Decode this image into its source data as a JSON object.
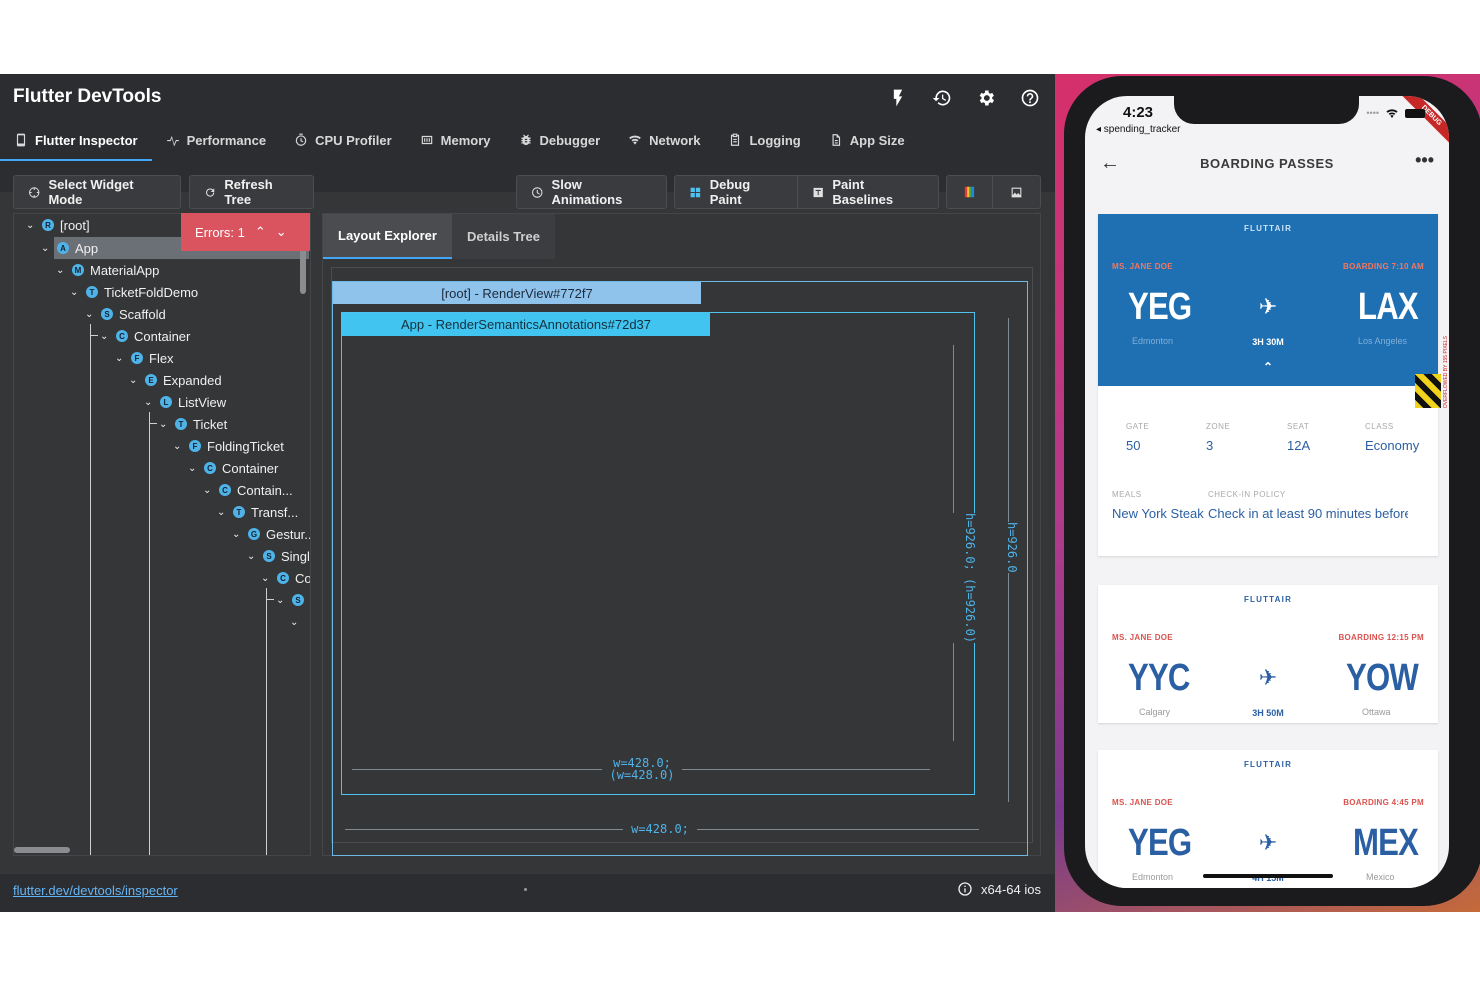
{
  "app": {
    "title": "Flutter DevTools",
    "tabs": [
      {
        "label": "Flutter Inspector",
        "icon": "phone-icon",
        "active": true
      },
      {
        "label": "Performance",
        "icon": "performance-icon"
      },
      {
        "label": "CPU Profiler",
        "icon": "timer-icon"
      },
      {
        "label": "Memory",
        "icon": "memory-icon"
      },
      {
        "label": "Debugger",
        "icon": "bug-icon"
      },
      {
        "label": "Network",
        "icon": "wifi-icon"
      },
      {
        "label": "Logging",
        "icon": "clipboard-icon"
      },
      {
        "label": "App Size",
        "icon": "file-icon"
      }
    ]
  },
  "toolbar": {
    "select_widget_mode": "Select Widget Mode",
    "refresh_tree": "Refresh Tree",
    "slow_animations": "Slow Animations",
    "debug_paint": "Debug Paint",
    "paint_baselines": "Paint Baselines"
  },
  "tree": {
    "errors_label": "Errors: 1",
    "nodes": [
      {
        "label": "[root]",
        "badge": "R"
      },
      {
        "label": "App",
        "badge": "A"
      },
      {
        "label": "MaterialApp",
        "badge": "M"
      },
      {
        "label": "TicketFoldDemo",
        "badge": "T"
      },
      {
        "label": "Scaffold",
        "badge": "S"
      },
      {
        "label": "Container",
        "badge": "C"
      },
      {
        "label": "Flex",
        "badge": "F"
      },
      {
        "label": "Expanded",
        "badge": "E"
      },
      {
        "label": "ListView",
        "badge": "L"
      },
      {
        "label": "Ticket",
        "badge": "T"
      },
      {
        "label": "FoldingTicket",
        "badge": "F"
      },
      {
        "label": "Container",
        "badge": "C"
      },
      {
        "label": "Contain...",
        "badge": "C"
      },
      {
        "label": "Transf...",
        "badge": "T"
      },
      {
        "label": "Gestur...",
        "badge": "G"
      },
      {
        "label": "Singl",
        "badge": "S"
      },
      {
        "label": "Co",
        "badge": "C"
      },
      {
        "label": "",
        "badge": "S"
      },
      {
        "label": "",
        "badge": ""
      }
    ]
  },
  "explorer": {
    "tabs": [
      "Layout Explorer",
      "Details Tree"
    ],
    "root_label": "[root] - RenderView#772f7",
    "app_label": "App - RenderSemanticsAnnotations#72d37",
    "inner_h": "h=926.0;",
    "inner_h_paren": "(h=926.0)",
    "inner_w": "w=428.0;",
    "inner_w_paren": "(w=428.0)",
    "outer_h": "h=926.0",
    "outer_w": "w=428.0;"
  },
  "footer": {
    "link": "flutter.dev/devtools/inspector",
    "platform": "x64-64 ios"
  },
  "phone": {
    "time": "4:23",
    "back_app": "◂ spending_tracker",
    "debug_banner": "DEBUG",
    "screen_title": "BOARDING PASSES",
    "brand": "FLUTTAIR",
    "overflow_warning": "OVERFLOWED BY 155 PIXELS",
    "tickets": [
      {
        "passenger": "MS. JANE DOE",
        "boarding": "BOARDING 7:10 AM",
        "from_code": "YEG",
        "from_city": "Edmonton",
        "to_code": "LAX",
        "to_city": "Los Angeles",
        "duration": "3H 30M",
        "details": {
          "gate_label": "GATE",
          "gate": "50",
          "zone_label": "ZONE",
          "zone": "3",
          "seat_label": "SEAT",
          "seat": "12A",
          "class_label": "CLASS",
          "class": "Economy",
          "meals_label": "MEALS",
          "meals": "New York Steak",
          "checkin_label": "CHECK-IN POLICY",
          "checkin": "Check in at least 90 minutes before t"
        }
      },
      {
        "passenger": "MS. JANE DOE",
        "boarding": "BOARDING 12:15 PM",
        "from_code": "YYC",
        "from_city": "Calgary",
        "to_code": "YOW",
        "to_city": "Ottawa",
        "duration": "3H 50M"
      },
      {
        "passenger": "MS. JANE DOE",
        "boarding": "BOARDING 4:45 PM",
        "from_code": "YEG",
        "from_city": "Edmonton",
        "to_code": "MEX",
        "to_city": "Mexico",
        "duration": "4H 15M"
      }
    ]
  },
  "colors": {
    "accent": "#42a5f5",
    "errors_bg": "#d9545f",
    "ticket_blue": "#1f6fb3",
    "ticket_text": "#2b5fa3",
    "boarding_red": "#d9534f"
  }
}
